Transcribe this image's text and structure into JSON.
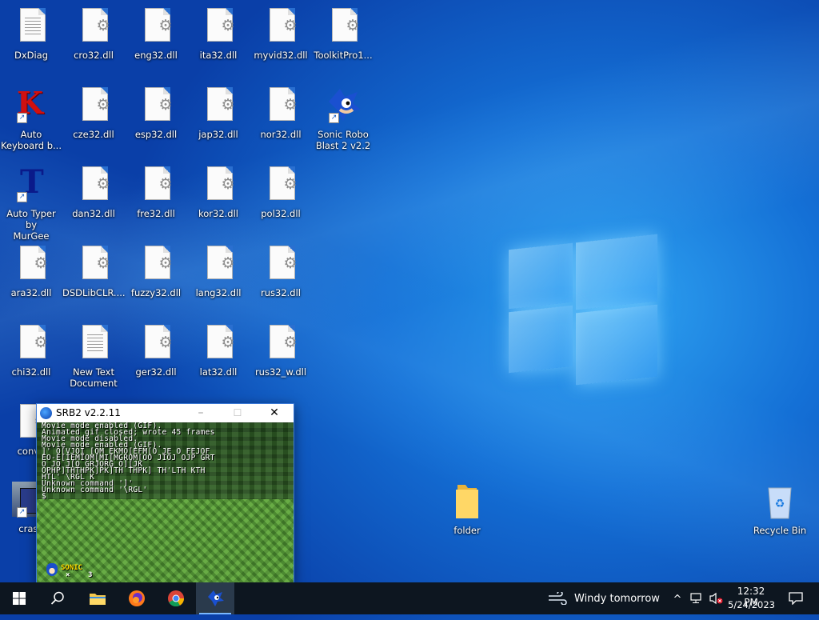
{
  "desktop": {
    "icons": [
      {
        "label": "DxDiag",
        "kind": "doc-lines"
      },
      {
        "label": "cro32.dll",
        "kind": "dll"
      },
      {
        "label": "eng32.dll",
        "kind": "dll"
      },
      {
        "label": "ita32.dll",
        "kind": "dll"
      },
      {
        "label": "myvid32.dll",
        "kind": "dll"
      },
      {
        "label": "ToolkitPro1...",
        "kind": "dll"
      },
      {
        "label": "Auto\nKeyboard b...",
        "kind": "app-k"
      },
      {
        "label": "cze32.dll",
        "kind": "dll"
      },
      {
        "label": "esp32.dll",
        "kind": "dll"
      },
      {
        "label": "jap32.dll",
        "kind": "dll"
      },
      {
        "label": "nor32.dll",
        "kind": "dll"
      },
      {
        "label": "Sonic Robo\nBlast 2 v2.2",
        "kind": "app-sonic"
      },
      {
        "label": "Auto Typer by\nMurGee",
        "kind": "app-t"
      },
      {
        "label": "dan32.dll",
        "kind": "dll"
      },
      {
        "label": "fre32.dll",
        "kind": "dll"
      },
      {
        "label": "kor32.dll",
        "kind": "dll"
      },
      {
        "label": "pol32.dll",
        "kind": "dll"
      },
      {
        "label": "ara32.dll",
        "kind": "dll"
      },
      {
        "label": "DSDLibCLR....",
        "kind": "dll"
      },
      {
        "label": "fuzzy32.dll",
        "kind": "dll"
      },
      {
        "label": "lang32.dll",
        "kind": "dll"
      },
      {
        "label": "rus32.dll",
        "kind": "dll"
      },
      {
        "label": "chi32.dll",
        "kind": "dll"
      },
      {
        "label": "New Text\nDocument",
        "kind": "doc-lines"
      },
      {
        "label": "ger32.dll",
        "kind": "dll"
      },
      {
        "label": "lat32.dll",
        "kind": "dll"
      },
      {
        "label": "rus32_w.dll",
        "kind": "dll"
      },
      {
        "label": "conv3",
        "kind": "dll"
      },
      {
        "label": "crash",
        "kind": "app-truck"
      },
      {
        "label": "folder",
        "kind": "folder"
      },
      {
        "label": "Recycle Bin",
        "kind": "recycle"
      }
    ]
  },
  "srb2_window": {
    "title": "SRB2 v2.2.11",
    "minimize": "–",
    "maximize": "☐",
    "close": "✕",
    "console_lines": [
      "Movie mode enabled (GIF).",
      "Animated gif closed; wrote 45 frames",
      "Movie mode disabled.",
      "Movie mode enabled (GIF).",
      "]' O[VJOI [OM EKMO[EFM[O JE O FEJOF",
      "EO-E[IEMIOM[MI[MGROM[OO JIOJ OJP GRT",
      "O JO J[O GRJORG O][JK",
      "OPHP]THTHPK]PK]TH THPK] TH'LTH KTH",
      "HTL' \\RGL K",
      "Unknown command ']'",
      "Unknown command '\\RGL'",
      "$"
    ],
    "hud_name": "SONIC",
    "hud_lives_prefix": "×",
    "hud_lives": "3"
  },
  "taskbar": {
    "weather": "Windy tomorrow",
    "time": "12:32 PM",
    "date": "5/24/2023",
    "start_icon": "windows-logo-icon",
    "pinned": [
      {
        "name": "search",
        "icon": "search-icon"
      },
      {
        "name": "file-explorer",
        "icon": "folder-icon"
      },
      {
        "name": "firefox",
        "icon": "firefox-icon"
      },
      {
        "name": "chrome",
        "icon": "chrome-icon"
      },
      {
        "name": "srb2",
        "icon": "sonic-icon"
      }
    ]
  },
  "colors": {
    "accent": "#7ab8ff",
    "taskbar_bg": "#0d1620",
    "desktop_blue": "#1470d6"
  }
}
